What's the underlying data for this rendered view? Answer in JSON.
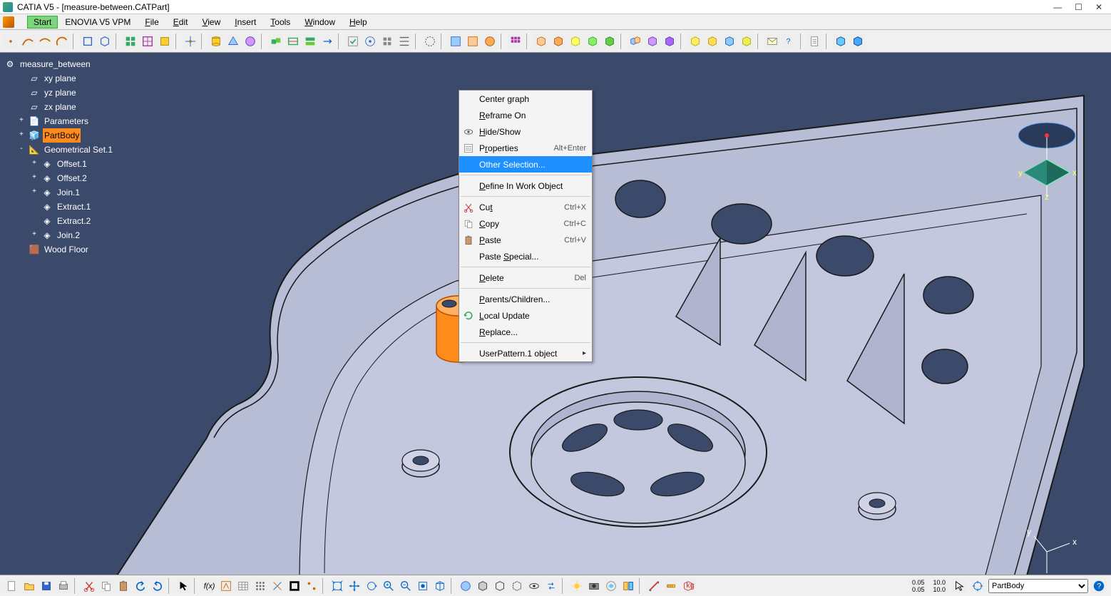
{
  "title": "CATIA V5 - [measure-between.CATPart]",
  "menubar": {
    "start": "Start",
    "items": [
      "ENOVIA V5 VPM",
      "File",
      "Edit",
      "View",
      "Insert",
      "Tools",
      "Window",
      "Help"
    ]
  },
  "tree": {
    "root": "measure_between",
    "items": [
      {
        "label": "xy plane",
        "type": "plane",
        "indent": 1
      },
      {
        "label": "yz plane",
        "type": "plane",
        "indent": 1
      },
      {
        "label": "zx plane",
        "type": "plane",
        "indent": 1
      },
      {
        "label": "Parameters",
        "type": "params",
        "indent": 1,
        "exp": "+"
      },
      {
        "label": "PartBody",
        "type": "body",
        "indent": 1,
        "exp": "+",
        "selected": true
      },
      {
        "label": "Geometrical Set.1",
        "type": "geoset",
        "indent": 1,
        "exp": "-"
      },
      {
        "label": "Offset.1",
        "type": "surf",
        "indent": 2,
        "exp": "+"
      },
      {
        "label": "Offset.2",
        "type": "surf",
        "indent": 2,
        "exp": "+"
      },
      {
        "label": "Join.1",
        "type": "surf",
        "indent": 2,
        "exp": "+"
      },
      {
        "label": "Extract.1",
        "type": "surf",
        "indent": 2
      },
      {
        "label": "Extract.2",
        "type": "surf",
        "indent": 2
      },
      {
        "label": "Join.2",
        "type": "surf",
        "indent": 2,
        "exp": "+"
      },
      {
        "label": "Wood Floor",
        "type": "mat",
        "indent": 1
      }
    ]
  },
  "context_menu": {
    "items": [
      {
        "label": "Center graph"
      },
      {
        "label": "Reframe On"
      },
      {
        "label": "Hide/Show",
        "icon": "eye"
      },
      {
        "label": "Properties",
        "icon": "props",
        "shortcut": "Alt+Enter"
      },
      {
        "label": "Other Selection...",
        "selected": true
      },
      {
        "sep": true
      },
      {
        "label": "Define In Work Object"
      },
      {
        "sep": true
      },
      {
        "label": "Cut",
        "icon": "cut",
        "shortcut": "Ctrl+X"
      },
      {
        "label": "Copy",
        "icon": "copy",
        "shortcut": "Ctrl+C"
      },
      {
        "label": "Paste",
        "icon": "paste",
        "shortcut": "Ctrl+V"
      },
      {
        "label": "Paste Special..."
      },
      {
        "sep": true
      },
      {
        "label": "Delete",
        "shortcut": "Del"
      },
      {
        "sep": true
      },
      {
        "label": "Parents/Children..."
      },
      {
        "label": "Local Update",
        "icon": "update"
      },
      {
        "label": "Replace..."
      },
      {
        "sep": true
      },
      {
        "label": "UserPattern.1 object",
        "submenu": true
      }
    ]
  },
  "statusbar": {
    "selector": "PartBody"
  },
  "colors": {
    "bg3d": "#3b4a6b",
    "part": "#b8bdd6",
    "edge": "#1a1a1a",
    "highlight": "#ff8c1a",
    "menusel": "#1e90ff"
  }
}
